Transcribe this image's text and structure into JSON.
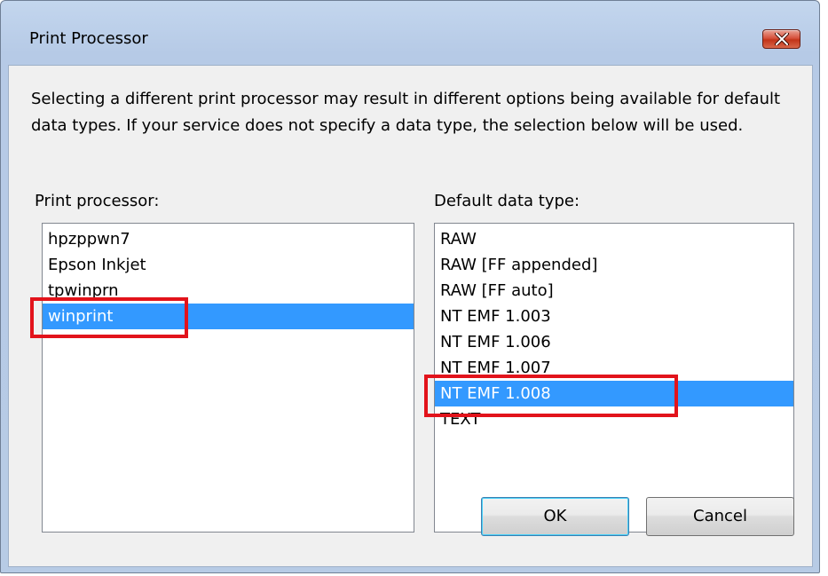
{
  "window": {
    "title": "Print Processor"
  },
  "description": "Selecting a different print processor may result in different options being available for default data types. If your service does not specify a data type, the selection below will be used.",
  "processor": {
    "label": "Print processor:",
    "items": [
      "hpzppwn7",
      "Epson Inkjet",
      "tpwinprn",
      "winprint"
    ],
    "selected_index": 3
  },
  "datatype": {
    "label": "Default data type:",
    "items": [
      "RAW",
      "RAW [FF appended]",
      "RAW [FF auto]",
      "NT EMF 1.003",
      "NT EMF 1.006",
      "NT EMF 1.007",
      "NT EMF 1.008",
      "TEXT"
    ],
    "selected_index": 6
  },
  "buttons": {
    "ok": "OK",
    "cancel": "Cancel"
  },
  "colors": {
    "selection": "#3399ff",
    "highlight_box": "#e2131b",
    "close_button": "#c23419"
  },
  "icons": {
    "close": "close-x-icon"
  }
}
